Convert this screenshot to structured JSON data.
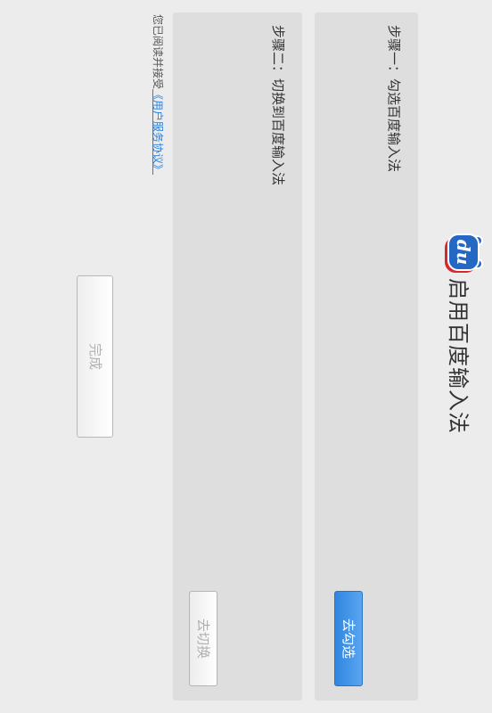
{
  "header": {
    "logo_text": "du",
    "title": "启用百度输入法"
  },
  "steps": [
    {
      "label": "步骤一：勾选百度输入法",
      "button": "去勾选"
    },
    {
      "label": "步骤二：切换到百度输入法",
      "button": "去切换"
    }
  ],
  "agreement": {
    "prefix": "您已阅读并接受",
    "link": "《用户服务协议》"
  },
  "done_button": "完成",
  "colors": {
    "primary": "#3a8ee6",
    "logo_blue": "#2468c4",
    "logo_red": "#d8262e",
    "link": "#2a7fd8"
  }
}
